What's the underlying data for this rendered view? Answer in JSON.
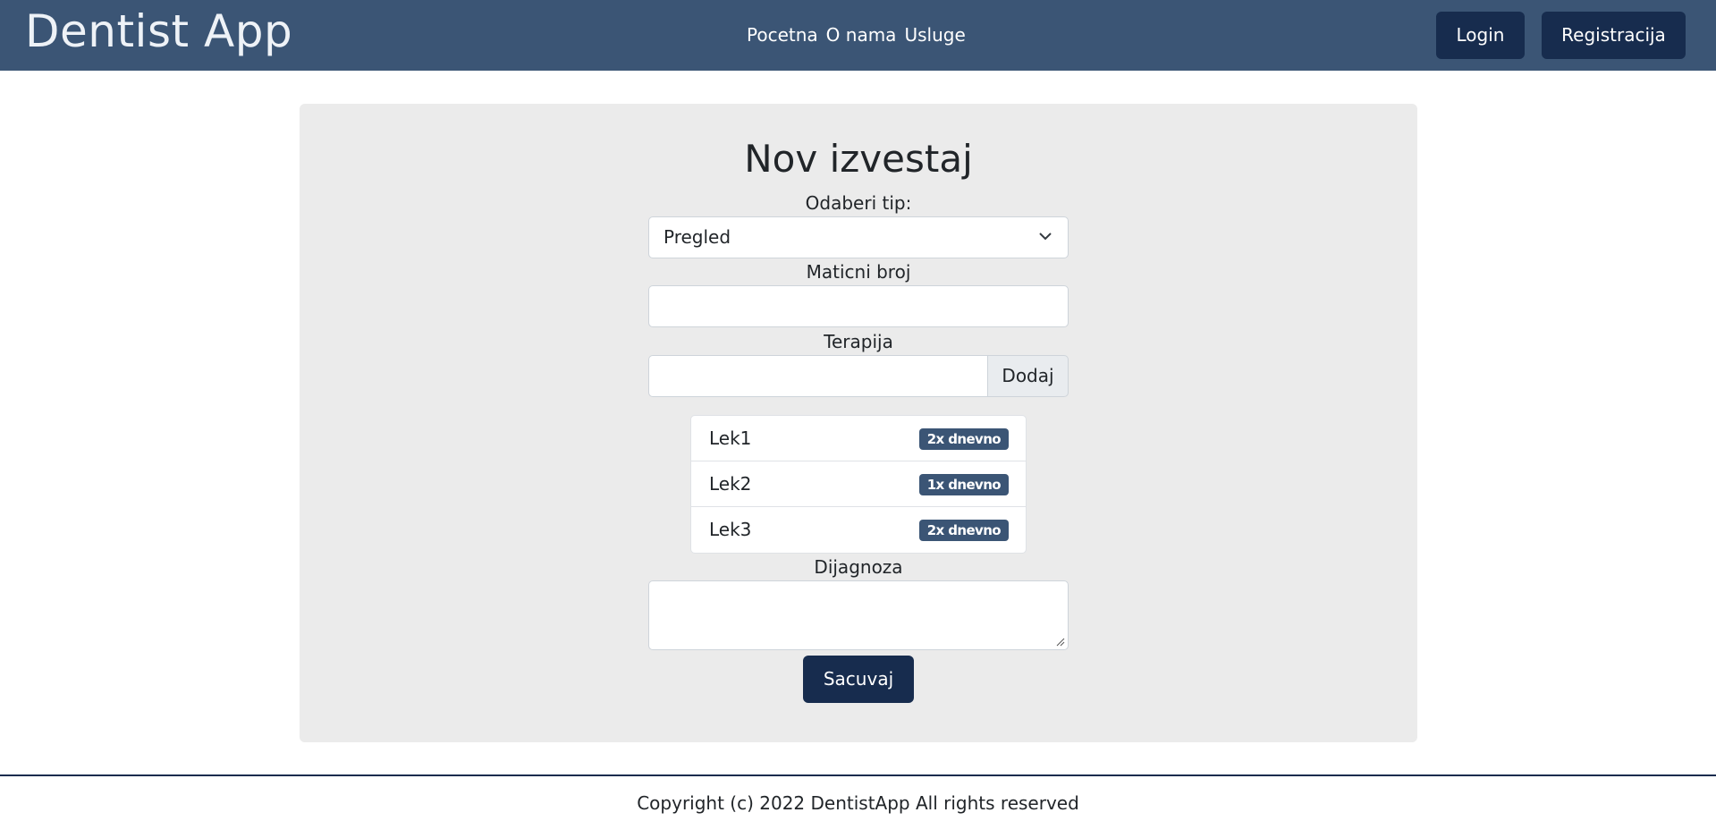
{
  "header": {
    "brand": "Dentist App",
    "nav": [
      "Pocetna",
      "O nama",
      "Usluge"
    ],
    "login_label": "Login",
    "register_label": "Registracija"
  },
  "form": {
    "title": "Nov izvestaj",
    "type_label": "Odaberi tip:",
    "type_value": "Pregled",
    "id_label": "Maticni broj",
    "id_value": "",
    "therapy_label": "Terapija",
    "therapy_value": "",
    "add_label": "Dodaj",
    "therapies": [
      {
        "name": "Lek1",
        "dose": "2x dnevno"
      },
      {
        "name": "Lek2",
        "dose": "1x dnevno"
      },
      {
        "name": "Lek3",
        "dose": "2x dnevno"
      }
    ],
    "diagnosis_label": "Dijagnoza",
    "diagnosis_value": "",
    "save_label": "Sacuvaj"
  },
  "footer": {
    "text": "Copyright (c) 2022 DentistApp All rights reserved"
  },
  "colors": {
    "navbar": "#3b5575",
    "button": "#172c4e",
    "card": "#ebebeb",
    "badge": "#3b5575"
  }
}
